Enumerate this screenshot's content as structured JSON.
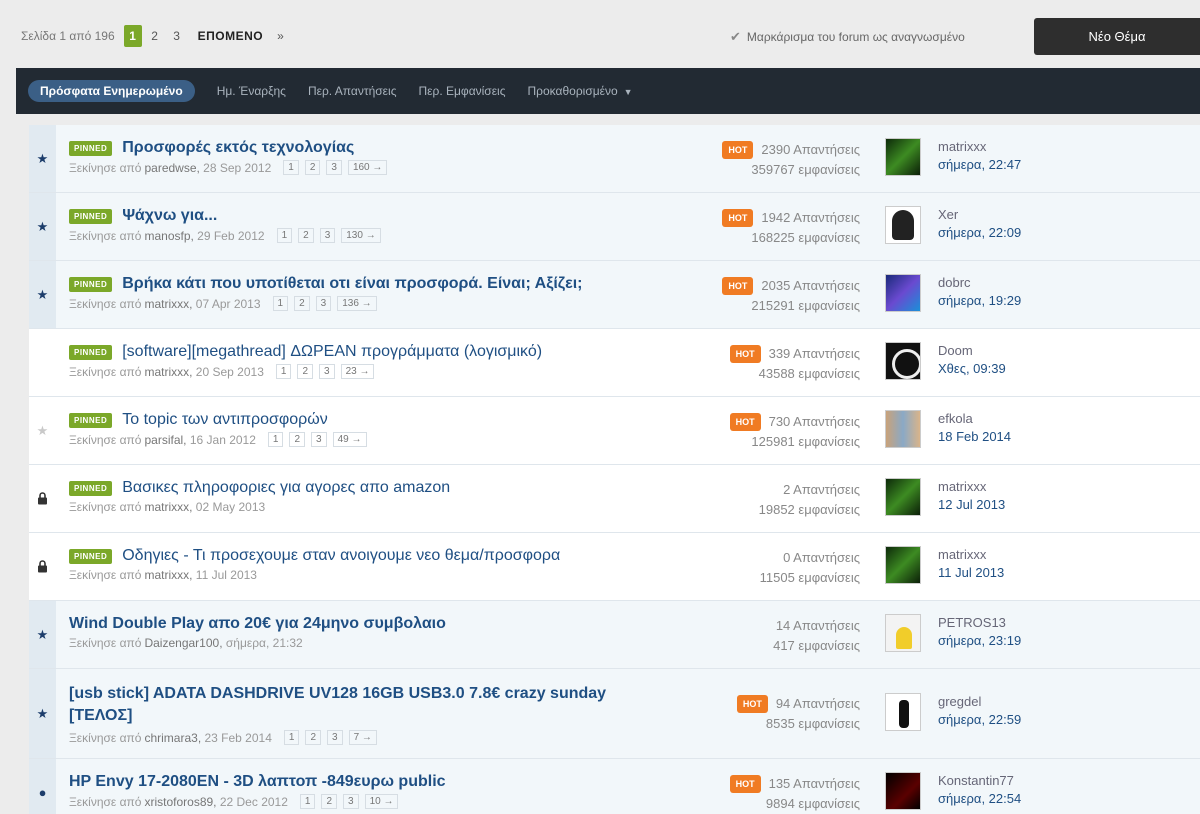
{
  "pager": {
    "label": "Σελίδα 1 από 196",
    "pages": [
      "1",
      "2",
      "3"
    ],
    "active": "1",
    "next": "ΕΠΟΜΕΝΟ",
    "last": "»"
  },
  "mark_read": "Μαρκάρισμα του forum ως αναγνωσμένο",
  "new_topic": "Νέο Θέμα",
  "tabs": [
    {
      "label": "Πρόσφατα Ενημερωμένο",
      "active": true
    },
    {
      "label": "Ημ. Έναρξης",
      "active": false
    },
    {
      "label": "Περ. Απαντήσεις",
      "active": false
    },
    {
      "label": "Περ. Εμφανίσεις",
      "active": false
    },
    {
      "label": "Προκαθορισμένο",
      "active": false,
      "caret": "▼"
    }
  ],
  "started_by": "Ξεκίνησε από",
  "pinned_label": "PINNED",
  "hot_label": "HOT",
  "topics": [
    {
      "status": "star",
      "pinned": true,
      "bold": true,
      "title": "Προσφορές εκτός τεχνολογίας",
      "author": "paredwse",
      "date": "28 Sep 2012",
      "pages": [
        "1",
        "2",
        "3",
        "160 →"
      ],
      "hot": true,
      "replies": "2390 Απαντήσεις",
      "views": "359767 εμφανίσεις",
      "avatar": "green",
      "last_user": "matrixxx",
      "last_time": "σήμερα, 22:47"
    },
    {
      "status": "star",
      "pinned": true,
      "bold": true,
      "title": "Ψάχνω για...",
      "author": "manosfp",
      "date": "29 Feb 2012",
      "pages": [
        "1",
        "2",
        "3",
        "130 →"
      ],
      "hot": true,
      "replies": "1942 Απαντήσεις",
      "views": "168225 εμφανίσεις",
      "avatar": "white",
      "last_user": "Xer",
      "last_time": "σήμερα, 22:09"
    },
    {
      "status": "star",
      "pinned": true,
      "bold": true,
      "title": "Βρήκα κάτι που υποτίθεται οτι είναι προσφορά. Είναι; Αξίζει;",
      "author": "matrixxx",
      "date": "07 Apr 2013",
      "pages": [
        "1",
        "2",
        "3",
        "136 →"
      ],
      "hot": true,
      "replies": "2035 Απαντήσεις",
      "views": "215291 εμφανίσεις",
      "avatar": "blue",
      "last_user": "dobrc",
      "last_time": "σήμερα, 19:29"
    },
    {
      "status": "none",
      "pinned": true,
      "bold": false,
      "title": "[software][megathread] ΔΩΡΕΑΝ προγράμματα (λογισμικό)",
      "author": "matrixxx",
      "date": "20 Sep 2013",
      "pages": [
        "1",
        "2",
        "3",
        "23 →"
      ],
      "hot": true,
      "replies": "339 Απαντήσεις",
      "views": "43588 εμφανίσεις",
      "avatar": "skull",
      "last_user": "Doom",
      "last_time": "Χθες, 09:39"
    },
    {
      "status": "star-empty",
      "pinned": true,
      "bold": false,
      "title": "Το topic των αντιπροσφορών",
      "author": "parsifal",
      "date": "16 Jan 2012",
      "pages": [
        "1",
        "2",
        "3",
        "49 →"
      ],
      "hot": true,
      "replies": "730 Απαντήσεις",
      "views": "125981 εμφανίσεις",
      "avatar": "photo",
      "last_user": "efkola",
      "last_time": "18 Feb 2014"
    },
    {
      "status": "lock",
      "pinned": true,
      "bold": false,
      "title": "Βασικες πληροφοριες για αγορες απο amazon",
      "author": "matrixxx",
      "date": "02 May 2013",
      "pages": [],
      "hot": false,
      "replies": "2 Απαντήσεις",
      "views": "19852 εμφανίσεις",
      "avatar": "green",
      "last_user": "matrixxx",
      "last_time": "12 Jul 2013"
    },
    {
      "status": "lock",
      "pinned": true,
      "bold": false,
      "title": "Οδηγιες - Τι προσεχουμε σταν ανοιγουμε νεο θεμα/προσφορα",
      "author": "matrixxx",
      "date": "11 Jul 2013",
      "pages": [],
      "hot": false,
      "replies": "0 Απαντήσεις",
      "views": "11505 εμφανίσεις",
      "avatar": "green",
      "last_user": "matrixxx",
      "last_time": "11 Jul 2013"
    },
    {
      "status": "star",
      "pinned": false,
      "bold": true,
      "title": "Wind Double Play απο 20€ για 24μηνο συμβολαιο",
      "author": "Daizengar100",
      "date": "σήμερα, 21:32",
      "pages": [],
      "hot": false,
      "replies": "14 Απαντήσεις",
      "views": "417 εμφανίσεις",
      "avatar": "minion",
      "last_user": "PETROS13",
      "last_time": "σήμερα, 23:19"
    },
    {
      "status": "star",
      "pinned": false,
      "bold": true,
      "tall": true,
      "title": "[usb stick] ADATA DASHDRIVE UV128 16GB USB3.0 7.8€ crazy sunday [ΤΕΛΟΣ]",
      "author": "chrimara3",
      "date": "23 Feb 2014",
      "pages": [
        "1",
        "2",
        "3",
        "7 →"
      ],
      "hot": true,
      "replies": "94 Απαντήσεις",
      "views": "8535 εμφανίσεις",
      "avatar": "hand",
      "last_user": "gregdel",
      "last_time": "σήμερα, 22:59"
    },
    {
      "status": "dot",
      "pinned": false,
      "bold": true,
      "title": "HP Envy 17-2080EN - 3D λαπτοπ -849ευρω public",
      "author": "xristoforos89",
      "date": "22 Dec 2012",
      "pages": [
        "1",
        "2",
        "3",
        "10 →"
      ],
      "hot": true,
      "replies": "135 Απαντήσεις",
      "views": "9894 εμφανίσεις",
      "avatar": "dark",
      "last_user": "Konstantin77",
      "last_time": "σήμερα, 22:54"
    }
  ],
  "colors": {
    "accent_green": "#7ba829",
    "hot_orange": "#f07b23",
    "link_blue": "#1f4f83",
    "nav_dark": "#222a33"
  },
  "icons": {
    "star": "star-icon",
    "star-empty": "star-outline-icon",
    "lock": "lock-icon",
    "dot": "unread-dot-icon",
    "check": "check-icon",
    "caret": "chevron-down-icon"
  }
}
